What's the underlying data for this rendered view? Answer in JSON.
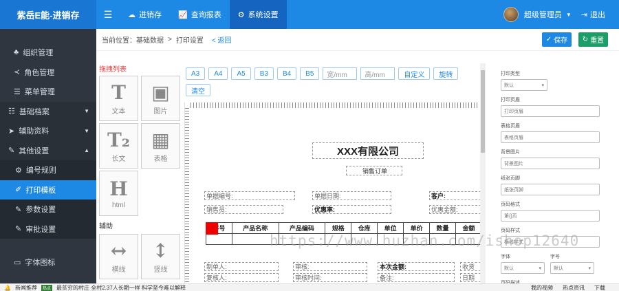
{
  "app": {
    "title": "紫岳E能-进销存"
  },
  "topnav": [
    {
      "icon": "cloud-icon",
      "label": "进销存"
    },
    {
      "icon": "chart-icon",
      "label": "查询报表"
    },
    {
      "icon": "gear-icon",
      "label": "系统设置"
    }
  ],
  "user": {
    "name": "超级管理员",
    "logout": "退出"
  },
  "sidebar": {
    "items": [
      {
        "label": "组织管理"
      },
      {
        "label": "角色管理"
      },
      {
        "label": "菜单管理"
      },
      {
        "label": "基础档案"
      },
      {
        "label": "辅助资料"
      },
      {
        "label": "其他设置"
      },
      {
        "label": "编号规则"
      },
      {
        "label": "打印模板"
      },
      {
        "label": "参数设置"
      },
      {
        "label": "审批设置"
      },
      {
        "label": "字体图标"
      }
    ]
  },
  "breadcrumb": {
    "prefix": "当前位置：",
    "level1": "基础数据",
    "sep": ">",
    "level2": "打印设置",
    "back": "< 返回"
  },
  "actions": {
    "save": "保存",
    "reset": "重置"
  },
  "palette": {
    "title": "拖拽列表",
    "tiles": [
      {
        "glyph": "T",
        "label": "文本"
      },
      {
        "glyph": "▣",
        "label": "图片"
      },
      {
        "glyph": "T₂",
        "label": "长文"
      },
      {
        "glyph": "▦",
        "label": "表格"
      },
      {
        "glyph": "H",
        "label": "html"
      }
    ],
    "aux_title": "辅助",
    "aux_tiles": [
      {
        "glyph": "↔",
        "label": "横线"
      },
      {
        "glyph": "↕",
        "label": "竖线"
      }
    ]
  },
  "toolbar": {
    "sizes": [
      "A3",
      "A4",
      "A5",
      "B3",
      "B4",
      "B5"
    ],
    "width_placeholder": "宽/mm",
    "height_placeholder": "高/mm",
    "custom": "自定义",
    "rotate": "旋转",
    "clear": "清空"
  },
  "canvas": {
    "company": "XXX有限公司",
    "doc_title": "销售订单",
    "fields": {
      "order_no": "单据编号:",
      "order_date": "单据日期:",
      "customer": "客户:",
      "salesperson": "销售员:",
      "discount": "优惠率:",
      "discount_amount": "优惠金额:",
      "maker": "制单人:",
      "auditor": "审核:",
      "total": "本次金额:",
      "reviewer": "复核人:",
      "review_time": "审核时间:",
      "remark": "备注:",
      "right_a": "收货",
      "right_b": "日期"
    },
    "table": {
      "headers": [
        "序号",
        "产品名称",
        "产品编码",
        "规格",
        "仓库",
        "单位",
        "单价",
        "数量",
        "金额"
      ]
    }
  },
  "props": {
    "labels": [
      "打印类型",
      "打印页眉",
      "表格页眉",
      "背景图片",
      "纸张页脚",
      "页码格式",
      "页码样式",
      "字体",
      "字号",
      "页码描述"
    ],
    "values": {
      "print_type": "默认",
      "header": "打印页眉",
      "table_header": "表格页眉",
      "bg": "背景图片",
      "footer": "纸张页脚",
      "page_fmt": "第{}页",
      "page_style": "横线样式",
      "font": "默认",
      "size": "默认"
    }
  },
  "watermark": "https://www.huzhan.com/ishop12640",
  "taskbar": {
    "news": "新闻推荐",
    "badge": "热点",
    "headline": "最贫穷的村庄 全村2.37人长期一样 科学至今难以解释",
    "right": [
      "我的视频",
      "热点资讯",
      "下载"
    ]
  }
}
